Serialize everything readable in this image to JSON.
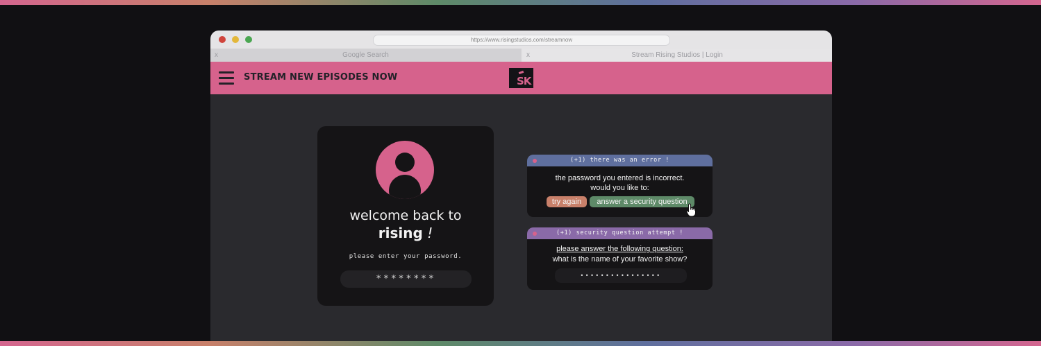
{
  "browser": {
    "url": "https://www.risingstudios.com/streamnow",
    "tabs": [
      {
        "close": "x",
        "title": "Google Search"
      },
      {
        "close": "x",
        "title": "Stream Rising Studios | Login"
      }
    ]
  },
  "header": {
    "title": "STREAM NEW EPISODES NOW",
    "logo_text": "SK"
  },
  "login": {
    "welcome": "welcome back to",
    "brand": "rising",
    "brand_suffix": "!",
    "prompt": "please enter your password.",
    "password_value": "********"
  },
  "error_dialog": {
    "title": "(+1) there was an error !",
    "line1": "the password you entered is incorrect.",
    "line2": "would you like to:",
    "try_again": "try again",
    "answer_question": "answer a security question"
  },
  "security_dialog": {
    "title": "(+1) security question attempt !",
    "line1": "please answer the following question:",
    "line2": "what is the name of your favorite show?",
    "answer_value": "••••••••••••••••"
  },
  "colors": {
    "accent_pink": "#d6628c",
    "error_blue": "#5f6f9e",
    "security_purple": "#8a6aa8",
    "try_orange": "#c8806a",
    "answer_green": "#5e8a68"
  }
}
